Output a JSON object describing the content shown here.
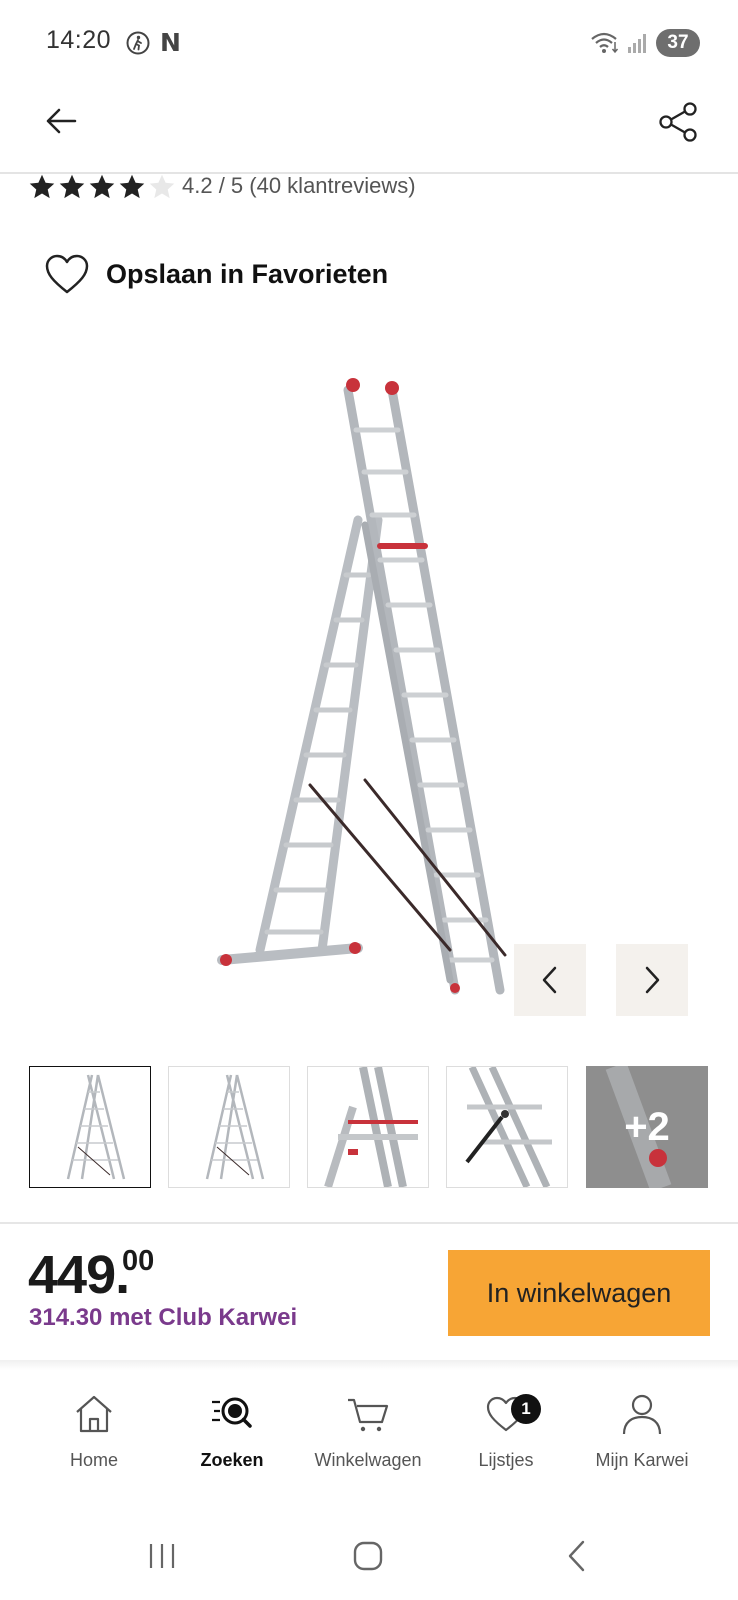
{
  "status_bar": {
    "time": "14:20",
    "battery": "37",
    "icons": [
      "walking-person-icon",
      "netflix-icon",
      "wifi-icon",
      "signal-icon"
    ]
  },
  "header": {
    "back_icon": "arrow-left-icon",
    "share_icon": "share-icon"
  },
  "rating": {
    "value": 4.2,
    "max": 5,
    "text": "4.2 / 5 (40 klantreviews)"
  },
  "favorite": {
    "icon": "heart-outline-icon",
    "label": "Opslaan in Favorieten"
  },
  "gallery": {
    "prev_icon": "chevron-left-icon",
    "next_icon": "chevron-right-icon",
    "thumbnails": [
      "ladder-full",
      "ladder-full",
      "ladder-detail",
      "ladder-detail",
      "ladder-detail"
    ],
    "more_label": "+2",
    "selected_index": 0
  },
  "price": {
    "main": "449.",
    "cents": "00",
    "club_price": "314.30 met Club Karwei"
  },
  "cart_button": {
    "label": "In winkelwagen"
  },
  "bottom_nav": {
    "items": [
      {
        "label": "Home",
        "icon": "home-icon",
        "active": false
      },
      {
        "label": "Zoeken",
        "icon": "search-icon",
        "active": true
      },
      {
        "label": "Winkelwagen",
        "icon": "cart-icon",
        "active": false
      },
      {
        "label": "Lijstjes",
        "icon": "heart-list-icon",
        "active": false,
        "badge": "1"
      },
      {
        "label": "Mijn Karwei",
        "icon": "user-icon",
        "active": false
      }
    ]
  },
  "colors": {
    "accent_orange": "#f7a535",
    "club_purple": "#7a3a8c",
    "gallery_button_bg": "#f4f1ed"
  }
}
